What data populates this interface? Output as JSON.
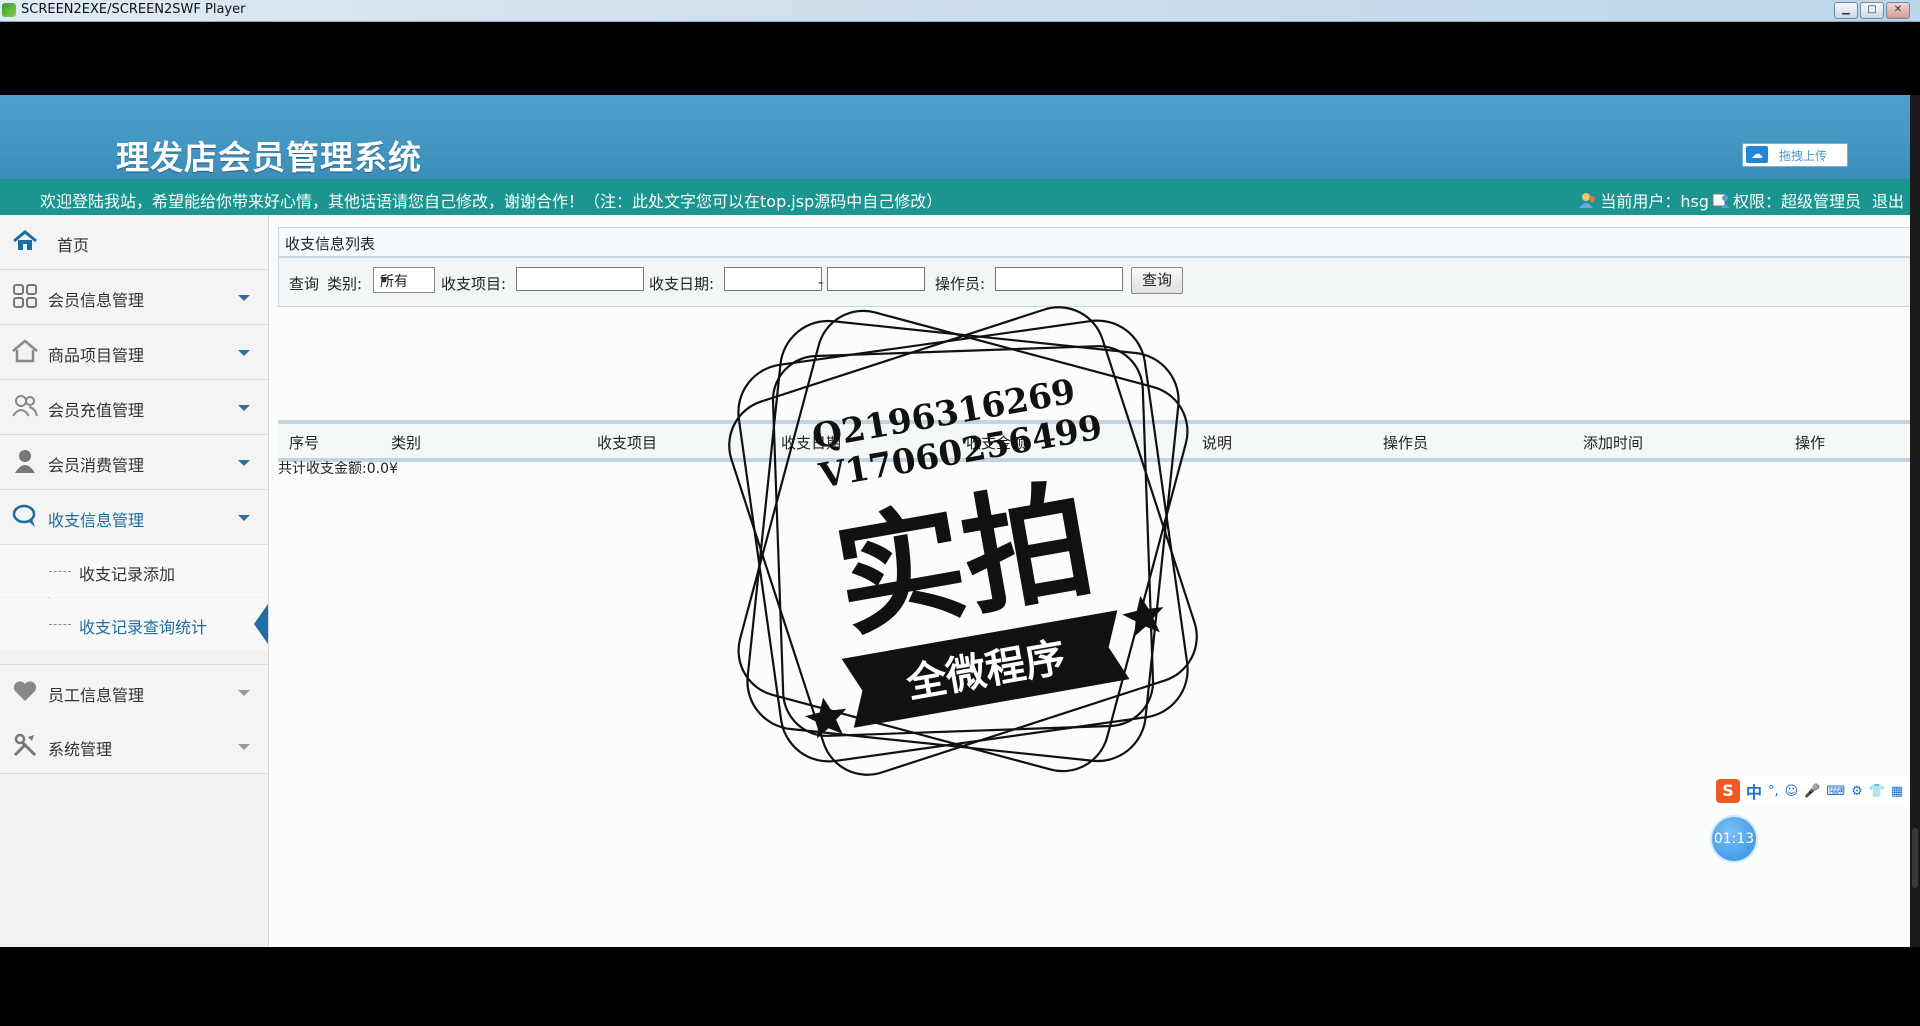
{
  "window": {
    "title": "SCREEN2EXE/SCREEN2SWF Player",
    "controls": [
      "▁",
      "□",
      "✕"
    ]
  },
  "header": {
    "system_title": "理发店会员管理系统",
    "upload_label": "拖拽上传"
  },
  "welcome_bar": {
    "message": "欢迎登陆我站，希望能给你带来好心情，其他话语请您自己修改，谢谢合作！（注：此处文字您可以在top.jsp源码中自己修改）",
    "current_user_label": "当前用户：hsg",
    "permission_label": "权限：超级管理员",
    "logout_label": "退出"
  },
  "sidebar": {
    "home": {
      "label": "首页",
      "icon": "home-icon"
    },
    "items": [
      {
        "label": "会员信息管理",
        "icon": "grid-icon"
      },
      {
        "label": "商品项目管理",
        "icon": "house-icon"
      },
      {
        "label": "会员充值管理",
        "icon": "users-icon"
      },
      {
        "label": "会员消费管理",
        "icon": "person-icon"
      },
      {
        "label": "收支信息管理",
        "icon": "chat-icon",
        "expanded": true
      },
      {
        "label": "员工信息管理",
        "icon": "heart-icon"
      },
      {
        "label": "系统管理",
        "icon": "tools-icon"
      }
    ],
    "subitems": [
      {
        "label": "收支记录添加"
      },
      {
        "label": "收支记录查询统计",
        "current": true
      }
    ]
  },
  "content": {
    "panel_title": "收支信息列表",
    "search": {
      "query_label": "查询",
      "category_label": "类别:",
      "category_value": "所有",
      "item_label": "收支项目:",
      "date_label": "收支日期:",
      "date_separator": "-",
      "operator_label": "操作员:",
      "search_button": "查询"
    },
    "table": {
      "columns": [
        "序号",
        "类别",
        "收支项目",
        "收支日期",
        "收支金额",
        "说明",
        "操作员",
        "添加时间",
        "操作"
      ]
    },
    "total_label": "共计收支金额:0.0¥"
  },
  "watermark": {
    "qq": "Q2196316269",
    "vx": "V17060256499",
    "main_text": "实拍",
    "ribbon_text": "全微程序"
  },
  "ime": {
    "cn_label": "中",
    "punct_label": "°,"
  },
  "timer": {
    "value": "01:13"
  }
}
